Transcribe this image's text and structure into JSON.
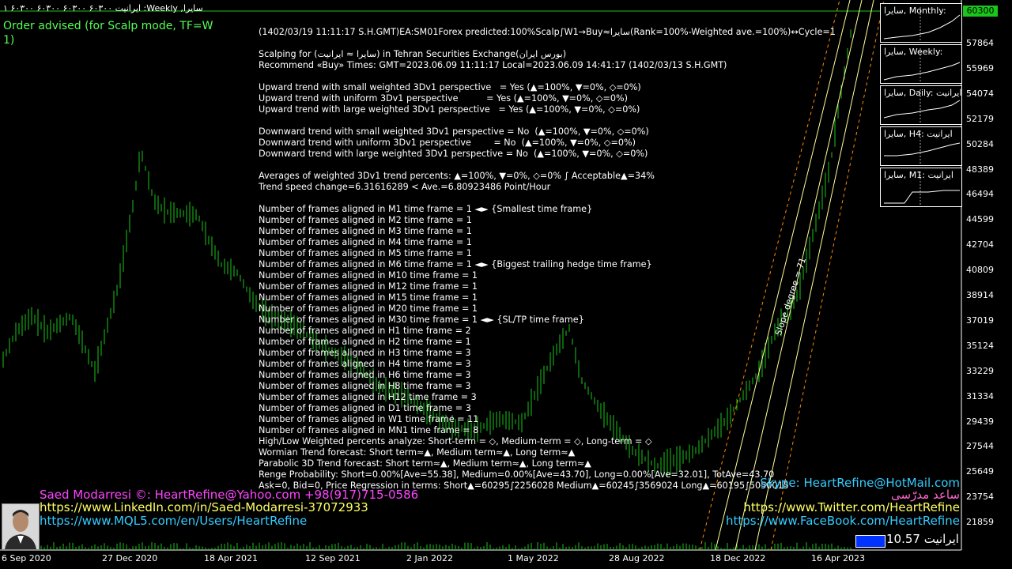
{
  "header": {
    "title": "ایرانیت ۶۰۳۰۰ ۶۰۳۰۰ ۶۰۳۰۰ ۶۰۳۰۰ ۱ :Weekly ,سایرا"
  },
  "advice": {
    "line1": "Order advised (for Scalp mode, TF=W",
    "line2": "1)"
  },
  "info_lines": [
    "(1402/03/19 11:11:17 S.H.GMT)EA:SM01Forex predicted:100%Scalp∫W1→Buy≈سایرا(Rank=100%-Weighted ave.=100%)↔Cycle=1",
    "",
    "Scalping for (سایرا ≈ ایرانیت) in Tehran Securities Exchange(بورس ایران)",
    "Recommend «Buy» Times: GMT=2023.06.09 11:11:17 Local=2023.06.09 14:41:17 (1402/03/13 S.H.GMT)",
    "",
    "Upward trend with small weighted 3Dv1 perspective   = Yes (▲=100%, ▼=0%, ◇=0%)",
    "Upward trend with uniform 3Dv1 perspective          = Yes (▲=100%, ▼=0%, ◇=0%)",
    "Upward trend with large weighted 3Dv1 perspective   = Yes (▲=100%, ▼=0%, ◇=0%)",
    "",
    "Downward trend with small weighted 3Dv1 perspective = No  (▲=100%, ▼=0%, ◇=0%)",
    "Downward trend with uniform 3Dv1 perspective        = No  (▲=100%, ▼=0%, ◇=0%)",
    "Downward trend with large weighted 3Dv1 perspective = No  (▲=100%, ▼=0%, ◇=0%)",
    "",
    "Averages of weighted 3Dv1 trend percents: ▲=100%, ▼=0%, ◇=0% ∫ Acceptable▲=34%",
    "Trend speed change=6.31616289 < Ave.=6.80923486 Point/Hour",
    "",
    "Number of frames aligned in M1 time frame = 1 ◄► {Smallest time frame}",
    "Number of frames aligned in M2 time frame = 1",
    "Number of frames aligned in M3 time frame = 1",
    "Number of frames aligned in M4 time frame = 1",
    "Number of frames aligned in M5 time frame = 1",
    "Number of frames aligned in M6 time frame = 1 ◄► {Biggest trailing hedge time frame}",
    "Number of frames aligned in M10 time frame = 1",
    "Number of frames aligned in M12 time frame = 1",
    "Number of frames aligned in M15 time frame = 1",
    "Number of frames aligned in M20 time frame = 1",
    "Number of frames aligned in M30 time frame = 1 ◄► {SL/TP time frame}",
    "Number of frames aligned in H1 time frame = 2",
    "Number of frames aligned in H2 time frame = 1",
    "Number of frames aligned in H3 time frame = 3",
    "Number of frames aligned in H4 time frame = 3",
    "Number of frames aligned in H6 time frame = 3",
    "Number of frames aligned in H8 time frame = 3",
    "Number of frames aligned in H12 time frame = 3",
    "Number of frames aligned in D1 time frame = 3",
    "Number of frames aligned in W1 time frame = 11",
    "Number of frames aligned in MN1 time frame = 8",
    "High/Low Weighted percents analyze: Short-term = ◇, Medium-term = ◇, Long-term = ◇",
    "Wormian Trend forecast: Short term≈▲, Medium term≈▲, Long term≈▲",
    "Parabolic 3D Trend forecast: Short term≈▲, Medium term≈▲, Long term≈▲",
    "Renge Probability: Short=0.00%[Ave=55.38], Medium=0.00%[Ave=43.70], Long=0.00%[Ave=32.01], TotAve=43.70",
    "Ask=0, Bid=0, Price Regression in terms: Short▲=60295∫2256028 Medium▲=60245∫3569024 Long▲=60195∫5050015"
  ],
  "y_axis": {
    "current": "60300",
    "labels": [
      "57864",
      "55969",
      "54074",
      "52179",
      "50284",
      "48389",
      "46494",
      "44599",
      "42704",
      "40809",
      "38914",
      "37019",
      "35124",
      "33229",
      "31334",
      "29439",
      "27544",
      "25649",
      "23754",
      "21859"
    ]
  },
  "x_axis": {
    "labels": [
      "6 Sep 2020",
      "27 Dec 2020",
      "18 Apr 2021",
      "12 Sep 2021",
      "2 Jan 2022",
      "1 May 2022",
      "28 Aug 2022",
      "18 Dec 2022",
      "16 Apr 2023"
    ]
  },
  "mini_charts": [
    {
      "title": "سایرا, Monthly:"
    },
    {
      "title": "سایرا, Weekly:"
    },
    {
      "title": "سایرا, Daily: ایرانیت"
    },
    {
      "title": "سایرا, H4: ایرانیت"
    },
    {
      "title": "سایرا, M1: ایرانیت"
    }
  ],
  "slope_label": "Slope degree = 71",
  "contacts": {
    "author": "Saed Modarresi ©: HeartRefine@Yahoo.com +98(917)715-0586",
    "linkedin": "https://www.LinkedIn.com/in/Saed-Modarresi-37072933",
    "mql5": "https://www.MQL5.com/en/Users/HeartRefine",
    "skype": "Skype: HeartRefine@HotMail.com",
    "name_fa": "ساعد مدرّسی",
    "twitter": "https://www.Twitter.com/HeartRefine",
    "facebook": "https://www.FaceBook.com/HeartRefine"
  },
  "ticker": {
    "value": "10.57",
    "symbol": "ایرانیت"
  },
  "colors": {
    "bars": "#19c619",
    "channel": "#ffff99",
    "channel_dash": "#ff8800",
    "hline": "#19c619",
    "magenta": "#ff44ff",
    "cyan": "#33ccff",
    "yellow": "#ffff66",
    "pink": "#ff66cc"
  }
}
